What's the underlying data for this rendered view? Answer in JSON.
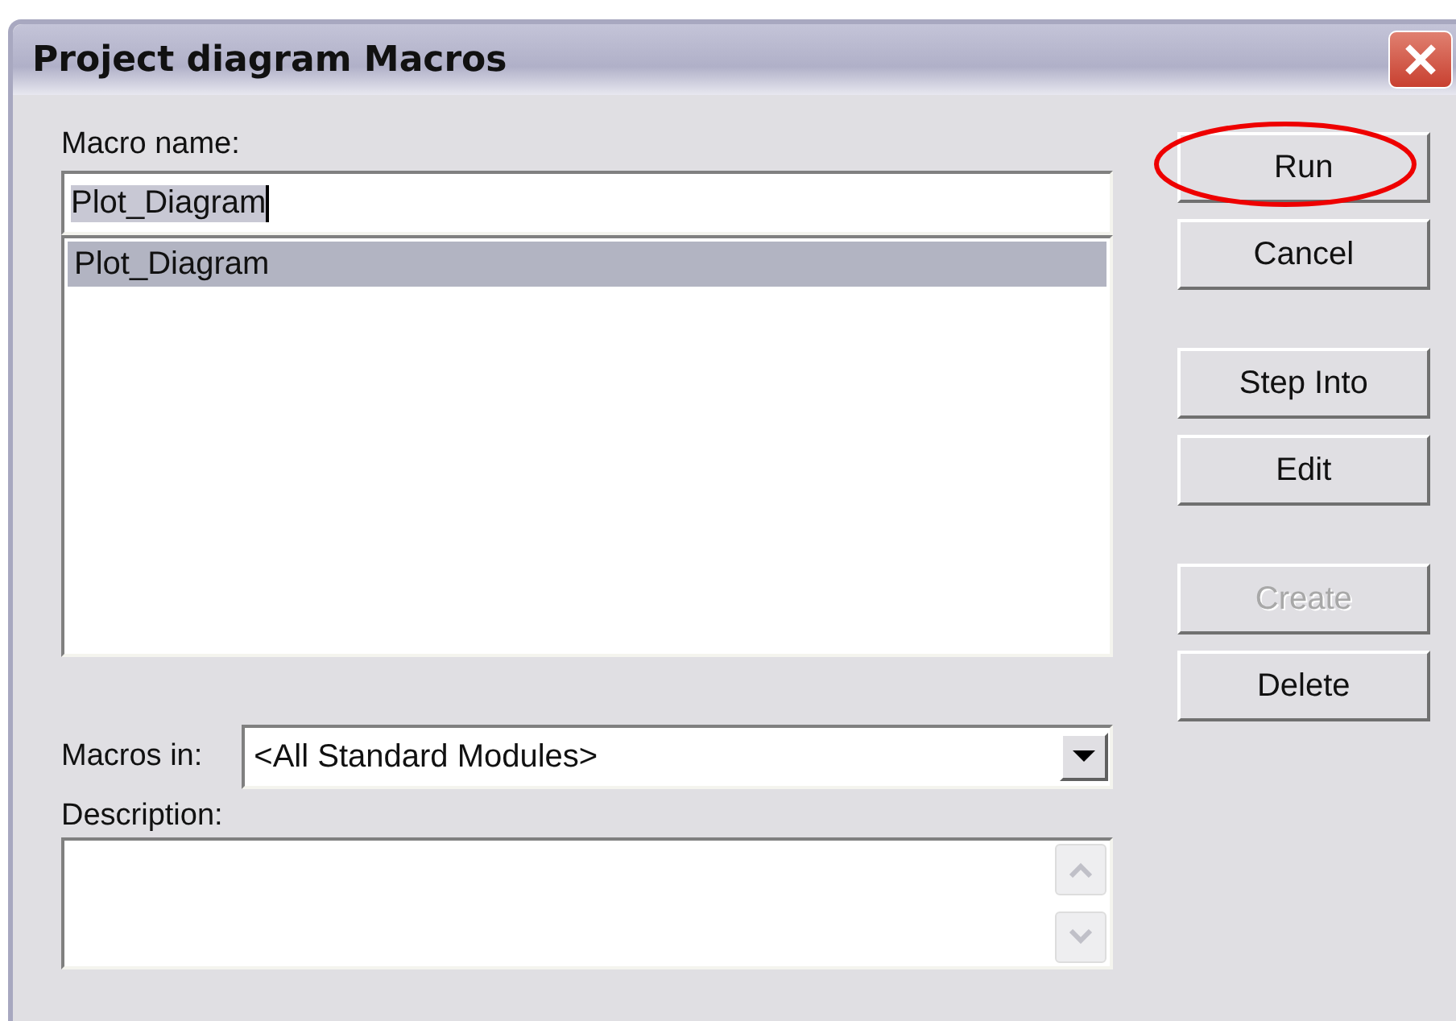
{
  "window": {
    "title": "Project diagram Macros"
  },
  "macro_name": {
    "label": "Macro name:",
    "value": "Plot_Diagram"
  },
  "macro_list": [
    {
      "label": "Plot_Diagram",
      "selected": true
    }
  ],
  "macros_in": {
    "label": "Macros in:",
    "value": "<All Standard Modules>"
  },
  "description": {
    "label": "Description:"
  },
  "button_groups": [
    [
      {
        "label": "Run",
        "disabled": false,
        "circled": true
      },
      {
        "label": "Cancel",
        "disabled": false,
        "circled": false
      }
    ],
    [
      {
        "label": "Step Into",
        "disabled": false,
        "circled": false
      },
      {
        "label": "Edit",
        "disabled": false,
        "circled": false
      }
    ],
    [
      {
        "label": "Create",
        "disabled": true,
        "circled": false
      },
      {
        "label": "Delete",
        "disabled": false,
        "circled": false
      }
    ]
  ]
}
